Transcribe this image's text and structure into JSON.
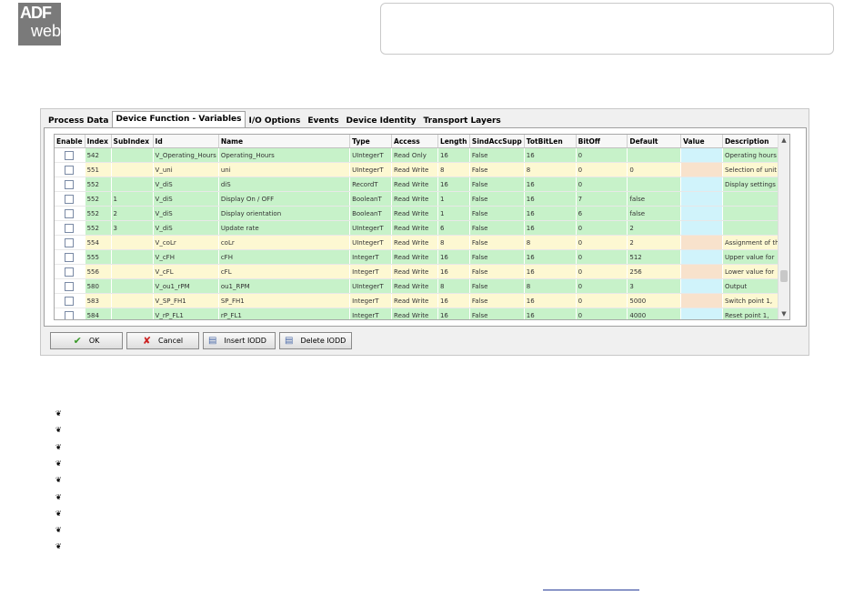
{
  "logo": {
    "line1": "ADF",
    "line2": "web"
  },
  "tabs": [
    "Process Data",
    "Device Function - Variables",
    "I/O Options",
    "Events",
    "Device Identity",
    "Transport Layers"
  ],
  "table": {
    "columns": [
      "Enable",
      "Index",
      "SubIndex",
      "Id",
      "Name",
      "Type",
      "Access",
      "Length",
      "SindAccSupp",
      "TotBitLen",
      "BitOff",
      "Default",
      "Value",
      "Description"
    ],
    "rows": [
      {
        "color": "g",
        "cells": [
          "",
          "542",
          "",
          "V_Operating_Hours",
          "Operating_Hours",
          "UIntegerT",
          "Read Only",
          "16",
          "False",
          "16",
          "0",
          "",
          "",
          "Operating hours"
        ]
      },
      {
        "color": "y",
        "cells": [
          "",
          "551",
          "",
          "V_uni",
          "uni",
          "UIntegerT",
          "Read Write",
          "8",
          "False",
          "8",
          "0",
          "0",
          "",
          "Selection of unit on"
        ]
      },
      {
        "color": "g",
        "cells": [
          "",
          "552",
          "",
          "V_diS",
          "diS",
          "RecordT",
          "Read Write",
          "16",
          "False",
          "16",
          "0",
          "",
          "",
          "Display settings"
        ]
      },
      {
        "color": "g",
        "cells": [
          "",
          "552",
          "1",
          "V_diS",
          "Display On / OFF",
          "BooleanT",
          "Read Write",
          "1",
          "False",
          "16",
          "7",
          "false",
          "",
          ""
        ]
      },
      {
        "color": "g",
        "cells": [
          "",
          "552",
          "2",
          "V_diS",
          "Display orientation",
          "BooleanT",
          "Read Write",
          "1",
          "False",
          "16",
          "6",
          "false",
          "",
          ""
        ]
      },
      {
        "color": "g",
        "cells": [
          "",
          "552",
          "3",
          "V_diS",
          "Update rate",
          "UIntegerT",
          "Read Write",
          "6",
          "False",
          "16",
          "0",
          "2",
          "",
          ""
        ]
      },
      {
        "color": "y",
        "cells": [
          "",
          "554",
          "",
          "V_coLr",
          "coLr",
          "UIntegerT",
          "Read Write",
          "8",
          "False",
          "8",
          "0",
          "2",
          "",
          "Assignment of the"
        ]
      },
      {
        "color": "g",
        "cells": [
          "",
          "555",
          "",
          "V_cFH",
          "cFH",
          "IntegerT",
          "Read Write",
          "16",
          "False",
          "16",
          "0",
          "512",
          "",
          "Upper value for"
        ]
      },
      {
        "color": "y",
        "cells": [
          "",
          "556",
          "",
          "V_cFL",
          "cFL",
          "IntegerT",
          "Read Write",
          "16",
          "False",
          "16",
          "0",
          "256",
          "",
          "Lower value for"
        ]
      },
      {
        "color": "g",
        "cells": [
          "",
          "580",
          "",
          "V_ou1_rPM",
          "ou1_RPM",
          "UIntegerT",
          "Read Write",
          "8",
          "False",
          "8",
          "0",
          "3",
          "",
          "Output"
        ]
      },
      {
        "color": "y",
        "cells": [
          "",
          "583",
          "",
          "V_SP_FH1",
          "SP_FH1",
          "IntegerT",
          "Read Write",
          "16",
          "False",
          "16",
          "0",
          "5000",
          "",
          "Switch point 1,"
        ]
      },
      {
        "color": "g",
        "cells": [
          "",
          "584",
          "",
          "V_rP_FL1",
          "rP_FL1",
          "IntegerT",
          "Read Write",
          "16",
          "False",
          "16",
          "0",
          "4000",
          "",
          "Reset point 1,"
        ]
      }
    ]
  },
  "buttons": {
    "ok": "OK",
    "cancel": "Cancel",
    "insert": "Insert IODD",
    "delete": "Delete IODD"
  },
  "bullet_glyph": "❦"
}
